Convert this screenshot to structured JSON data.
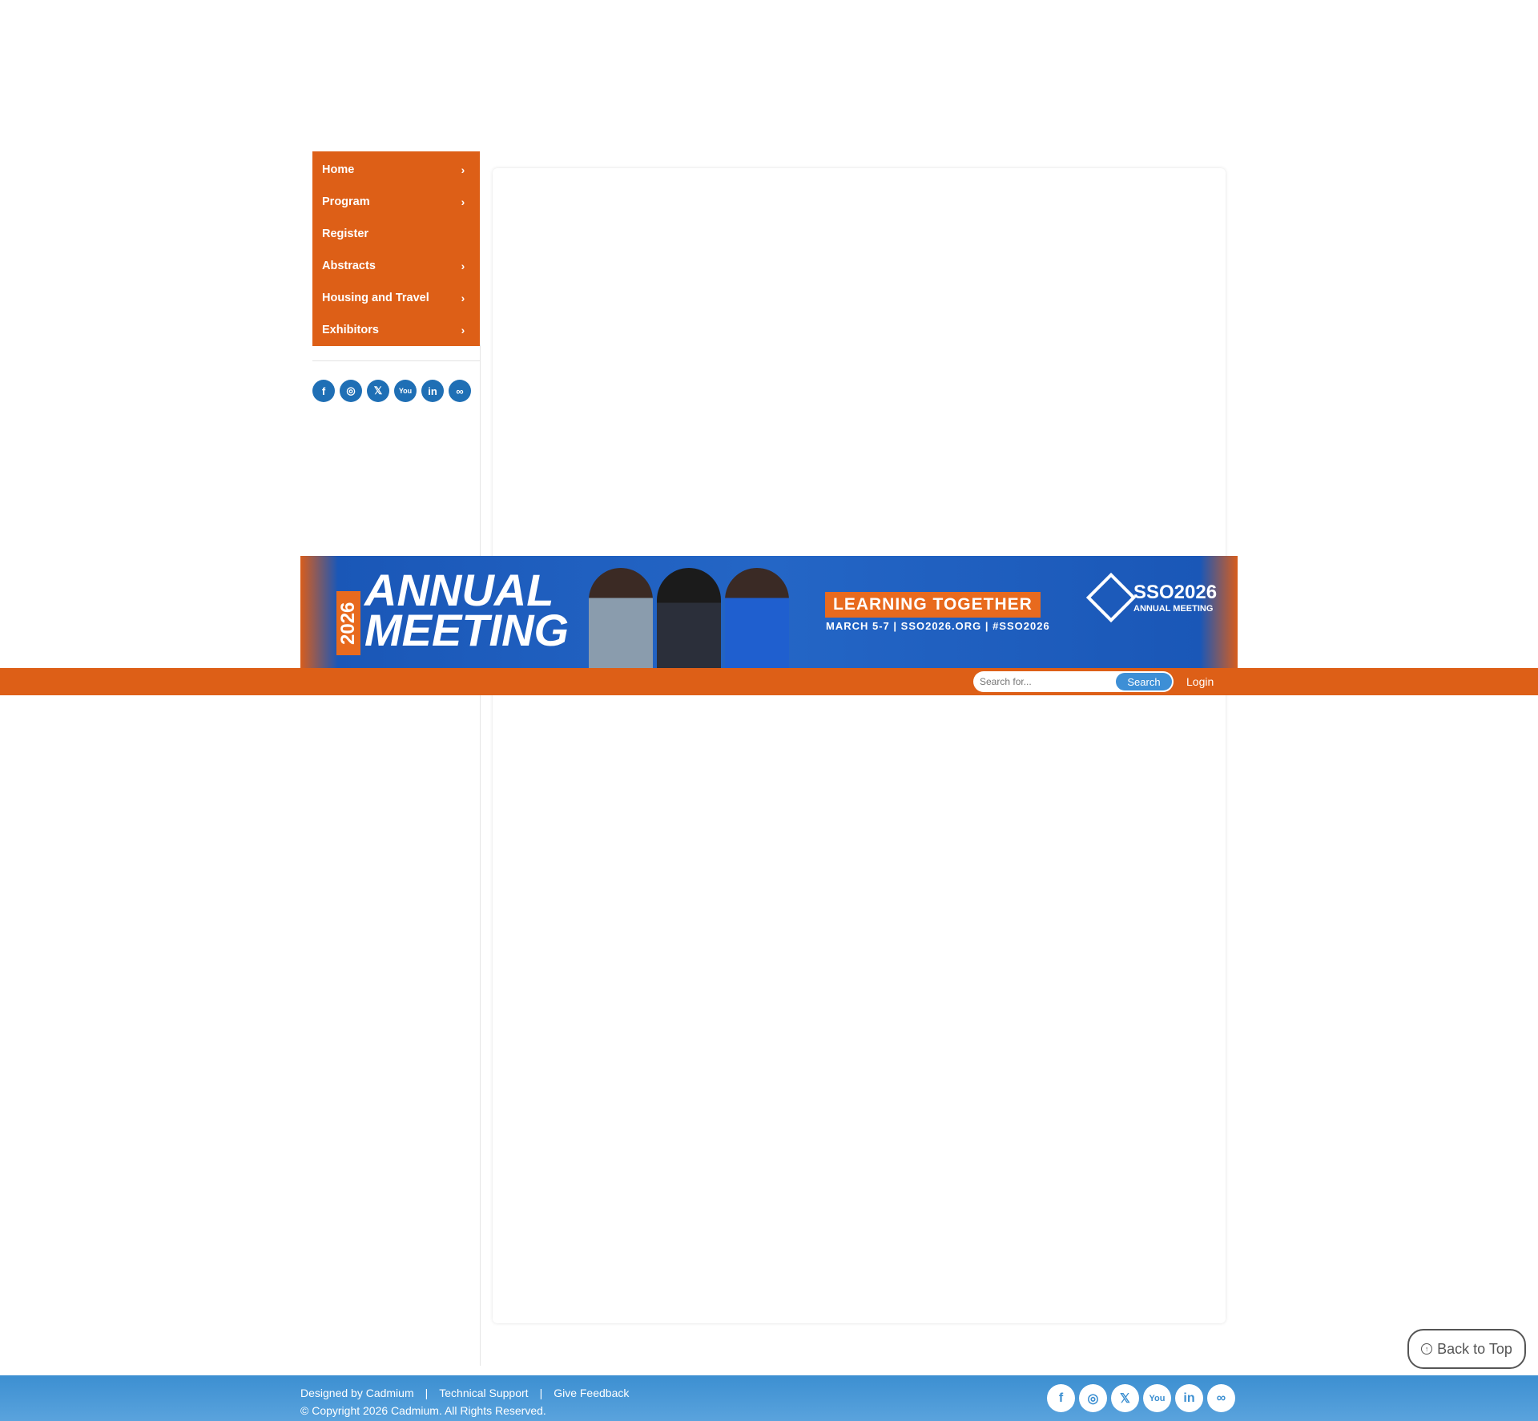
{
  "nav": {
    "items": [
      {
        "label": "Home",
        "has_submenu": true
      },
      {
        "label": "Program",
        "has_submenu": true
      },
      {
        "label": "Register",
        "has_submenu": false
      },
      {
        "label": "Abstracts",
        "has_submenu": true
      },
      {
        "label": "Housing and Travel",
        "has_submenu": true
      },
      {
        "label": "Exhibitors",
        "has_submenu": true
      }
    ],
    "chevron": "›"
  },
  "social": {
    "icons": [
      "facebook-icon",
      "instagram-icon",
      "x-icon",
      "youtube-icon",
      "linkedin-icon",
      "link-icon"
    ],
    "glyphs": [
      "f",
      "◎",
      "𝕏",
      "You",
      "in",
      "∞"
    ]
  },
  "banner": {
    "year": "2026",
    "title_line1": "ANNUAL",
    "title_line2": "MEETING",
    "tagline": "LEARNING TOGETHER",
    "details": "MARCH 5-7 | SSO2026.ORG | #SSO2026",
    "logo_main": "SSO2026",
    "logo_sub": "ANNUAL MEETING"
  },
  "topbar": {
    "search_placeholder": "Search for...",
    "search_button": "Search",
    "login": "Login"
  },
  "back_to_top": "Back to Top",
  "footer": {
    "designed_by": "Designed by Cadmium",
    "technical_support": "Technical Support",
    "give_feedback": "Give Feedback",
    "separator": "|",
    "copyright": "© Copyright 2026 Cadmium. All Rights Reserved."
  },
  "colors": {
    "brand_orange": "#dd5f17",
    "brand_blue": "#1f6fb5",
    "footer_blue": "#3c8fd1"
  }
}
